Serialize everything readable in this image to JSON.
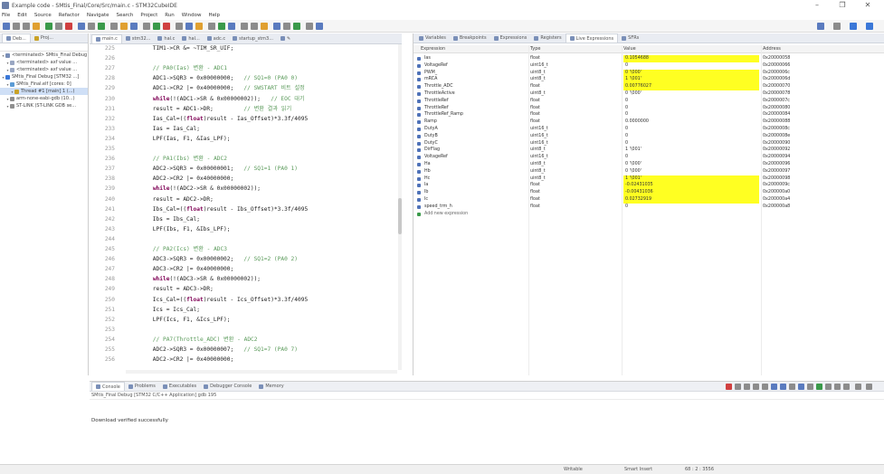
{
  "window": {
    "title": "Example code - SMtis_Final/Core/Src/main.c - STM32CubeIDE",
    "controls": [
      "–",
      "❐",
      "✕"
    ]
  },
  "menu": [
    "File",
    "Edit",
    "Source",
    "Refactor",
    "Navigate",
    "Search",
    "Project",
    "Run",
    "Window",
    "Help"
  ],
  "left_panel": {
    "tabs": [
      "Deb...",
      "Proj..."
    ],
    "tree": [
      {
        "label": "<terminated> SMtis_Final Debug",
        "indent": 0,
        "color": "#7a8fb8"
      },
      {
        "label": "<terminated> axf value ...",
        "indent": 1,
        "color": "#9aa7c2"
      },
      {
        "label": "<terminated> axf value ...",
        "indent": 1,
        "color": "#9aa7c2"
      },
      {
        "label": "SMtis_Final Debug [STM32 ...]",
        "indent": 0,
        "color": "#3b78d8"
      },
      {
        "label": "SMtis_Final.elf [cores: 0]",
        "indent": 1,
        "color": "#5b9bd5"
      },
      {
        "label": "Thread #1 [main] 1 (...)",
        "indent": 2,
        "color": "#c9a227",
        "selected": true
      },
      {
        "label": "arm-none-eabi-gdb (10...)",
        "indent": 1,
        "color": "#8f8f8f"
      },
      {
        "label": "ST-LINK (ST-LINK GDB se...",
        "indent": 1,
        "color": "#8f8f8f"
      }
    ]
  },
  "editor": {
    "tabs": [
      "main.c",
      "stm32...",
      "hal.c",
      "hal...",
      "adc.c",
      "startup_stm3...",
      "✎"
    ],
    "lines": [
      {
        "n": "225",
        "segments": [
          {
            "t": "        TIM1->CR &= ~TIM_SR_UIF;"
          }
        ]
      },
      {
        "n": "226",
        "segments": [
          {
            "t": ""
          }
        ]
      },
      {
        "n": "227",
        "segments": [
          {
            "t": "        // PA0(Ias) 변환 - ADC1",
            "c": "cm"
          }
        ]
      },
      {
        "n": "228",
        "segments": [
          {
            "t": "        ADC1->SQR3 = 0x00000000;   "
          },
          {
            "t": "// SQ1=0 (PA0 0)",
            "c": "cm"
          }
        ]
      },
      {
        "n": "229",
        "segments": [
          {
            "t": "        ADC1->CR2 |= 0x40000000;   "
          },
          {
            "t": "// SWSTART 비트 설정",
            "c": "cm"
          }
        ]
      },
      {
        "n": "230",
        "segments": [
          {
            "t": "        ",
            "c": ""
          },
          {
            "t": "while",
            "c": "kw"
          },
          {
            "t": "(!(ADC1->SR & 0x00000002));   "
          },
          {
            "t": "// EOC 대기",
            "c": "cm"
          }
        ]
      },
      {
        "n": "231",
        "segments": [
          {
            "t": "        result = ADC1->DR;         "
          },
          {
            "t": "// 변환 결과 읽기",
            "c": "cm"
          }
        ]
      },
      {
        "n": "232",
        "segments": [
          {
            "t": "        Ias_Cal=(("
          },
          {
            "t": "float",
            "c": "kw"
          },
          {
            "t": ")result - Ias_Offset)*3.3f/4095"
          }
        ]
      },
      {
        "n": "233",
        "segments": [
          {
            "t": "        Ias = Ias_Cal;"
          }
        ]
      },
      {
        "n": "234",
        "segments": [
          {
            "t": "        LPF(Ias, F1, &Ias_LPF);"
          }
        ]
      },
      {
        "n": "235",
        "segments": [
          {
            "t": ""
          }
        ]
      },
      {
        "n": "236",
        "segments": [
          {
            "t": "        // PA1(Ibs) 변환 - ADC2",
            "c": "cm"
          }
        ]
      },
      {
        "n": "237",
        "segments": [
          {
            "t": "        ADC2->SQR3 = 0x00000001;   "
          },
          {
            "t": "// SQ1=1 (PA0 1)",
            "c": "cm"
          }
        ]
      },
      {
        "n": "238",
        "segments": [
          {
            "t": "        ADC2->CR2 |= 0x40000000;"
          }
        ]
      },
      {
        "n": "239",
        "segments": [
          {
            "t": "        ",
            "c": ""
          },
          {
            "t": "while",
            "c": "kw"
          },
          {
            "t": "(!(ADC2->SR & 0x00000002));"
          }
        ]
      },
      {
        "n": "240",
        "segments": [
          {
            "t": "        result = ADC2->DR;"
          }
        ]
      },
      {
        "n": "241",
        "segments": [
          {
            "t": "        Ibs_Cal=(("
          },
          {
            "t": "float",
            "c": "kw"
          },
          {
            "t": ")result - Ibs_Offset)*3.3f/4095"
          }
        ]
      },
      {
        "n": "242",
        "segments": [
          {
            "t": "        Ibs = Ibs_Cal;"
          }
        ]
      },
      {
        "n": "243",
        "segments": [
          {
            "t": "        LPF(Ibs, F1, &Ibs_LPF);"
          }
        ]
      },
      {
        "n": "244",
        "segments": [
          {
            "t": ""
          }
        ]
      },
      {
        "n": "245",
        "segments": [
          {
            "t": "        // PA2(Ics) 변환 - ADC3",
            "c": "cm"
          }
        ]
      },
      {
        "n": "246",
        "segments": [
          {
            "t": "        ADC3->SQR3 = 0x00000002;   "
          },
          {
            "t": "// SQ1=2 (PA0 2)",
            "c": "cm"
          }
        ]
      },
      {
        "n": "247",
        "segments": [
          {
            "t": "        ADC3->CR2 |= 0x40000000;"
          }
        ]
      },
      {
        "n": "248",
        "segments": [
          {
            "t": "        ",
            "c": ""
          },
          {
            "t": "while",
            "c": "kw"
          },
          {
            "t": "(!(ADC3->SR & 0x00000002));"
          }
        ]
      },
      {
        "n": "249",
        "segments": [
          {
            "t": "        result = ADC3->DR;"
          }
        ]
      },
      {
        "n": "250",
        "segments": [
          {
            "t": "        Ics_Cal=(("
          },
          {
            "t": "float",
            "c": "kw"
          },
          {
            "t": ")result - Ics_Offset)*3.3f/4095"
          }
        ]
      },
      {
        "n": "251",
        "segments": [
          {
            "t": "        Ics = Ics_Cal;"
          }
        ]
      },
      {
        "n": "252",
        "segments": [
          {
            "t": "        LPF(Ics, F1, &Ics_LPF);"
          }
        ]
      },
      {
        "n": "253",
        "segments": [
          {
            "t": ""
          }
        ]
      },
      {
        "n": "254",
        "segments": [
          {
            "t": "        // PA7(Throttle_ADC) 변환 - ADC2",
            "c": "cm"
          }
        ]
      },
      {
        "n": "255",
        "segments": [
          {
            "t": "        ADC2->SQR3 = 0x00000007;   "
          },
          {
            "t": "// SQ1=7 (PA0 7)",
            "c": "cm"
          }
        ]
      },
      {
        "n": "256",
        "segments": [
          {
            "t": "        ADC2->CR2 |= 0x40000000;"
          }
        ]
      }
    ]
  },
  "expressions": {
    "tabs": [
      "Variables",
      "Breakpoints",
      "Expressions",
      "Registers",
      "Live Expressions",
      "SFRs"
    ],
    "active_tab": "Live Expressions",
    "columns": [
      "Expression",
      "Type",
      "Value",
      "Address"
    ],
    "rows": [
      {
        "expr": "Ias",
        "type": "float",
        "value": "0.1054688",
        "addr": "0x20000058",
        "hl": true
      },
      {
        "expr": "VoltageRef",
        "type": "uint16_t",
        "value": "0",
        "addr": "0x20000066",
        "hl": false
      },
      {
        "expr": "PWM_",
        "type": "uint8_t",
        "value": "0 '\\000'",
        "addr": "0x2000006c",
        "hl": true
      },
      {
        "expr": "mRCA",
        "type": "uint8_t",
        "value": "1 '\\001'",
        "addr": "0x2000006d",
        "hl": true
      },
      {
        "expr": "Throttle_ADC",
        "type": "float",
        "value": "0.00776027",
        "addr": "0x20000070",
        "hl": true
      },
      {
        "expr": "ThrottleActive",
        "type": "uint8_t",
        "value": "0 '\\000'",
        "addr": "0x20000078",
        "hl": false
      },
      {
        "expr": "ThrottleRef",
        "type": "float",
        "value": "0",
        "addr": "0x2000007c",
        "hl": false
      },
      {
        "expr": "ThrottleRef",
        "type": "float",
        "value": "0",
        "addr": "0x20000080",
        "hl": false
      },
      {
        "expr": "ThrottleRef_Ramp",
        "type": "float",
        "value": "0",
        "addr": "0x20000084",
        "hl": false
      },
      {
        "expr": "Ramp",
        "type": "float",
        "value": "0.0000000",
        "addr": "0x20000088",
        "hl": false
      },
      {
        "expr": "DutyA",
        "type": "uint16_t",
        "value": "0",
        "addr": "0x2000008c",
        "hl": false
      },
      {
        "expr": "DutyB",
        "type": "uint16_t",
        "value": "0",
        "addr": "0x2000008e",
        "hl": false
      },
      {
        "expr": "DutyC",
        "type": "uint16_t",
        "value": "0",
        "addr": "0x20000090",
        "hl": false
      },
      {
        "expr": "DirFlag",
        "type": "uint8_t",
        "value": "1 '\\001'",
        "addr": "0x20000092",
        "hl": false
      },
      {
        "expr": "VoltageRef",
        "type": "uint16_t",
        "value": "0",
        "addr": "0x20000094",
        "hl": false
      },
      {
        "expr": "Ha",
        "type": "uint8_t",
        "value": "0 '\\000'",
        "addr": "0x20000096",
        "hl": false
      },
      {
        "expr": "Hb",
        "type": "uint8_t",
        "value": "0 '\\000'",
        "addr": "0x20000097",
        "hl": false
      },
      {
        "expr": "Hc",
        "type": "uint8_t",
        "value": "1 '\\001'",
        "addr": "0x20000098",
        "hl": true
      },
      {
        "expr": "Ia",
        "type": "float",
        "value": "-0.02431035",
        "addr": "0x2000009c",
        "hl": true
      },
      {
        "expr": "Ib",
        "type": "float",
        "value": "-0.00431036",
        "addr": "0x200000a0",
        "hl": true
      },
      {
        "expr": "Ic",
        "type": "float",
        "value": "0.02732919",
        "addr": "0x200000a4",
        "hl": true
      },
      {
        "expr": "speed_trm_h",
        "type": "float",
        "value": "0",
        "addr": "0x200000a8",
        "hl": false
      },
      {
        "expr": "Add new expression",
        "type": "",
        "value": "",
        "addr": "",
        "hl": false,
        "add": true
      }
    ]
  },
  "console": {
    "tabs": [
      "Console",
      "Problems",
      "Executables",
      "Debugger Console",
      "Memory"
    ],
    "subtitle": "SMtis_Final Debug [STM32 C/C++ Application] gdb 195",
    "output": "Download verified successfully"
  },
  "status": {
    "mode": "Writable",
    "insert": "Smart Insert",
    "position": "68 : 2 : 3556"
  },
  "colors": {
    "highlight": "#ffff22",
    "selection": "#cfdff6",
    "comment": "#5a9a5a",
    "keyword": "#7f0055"
  }
}
